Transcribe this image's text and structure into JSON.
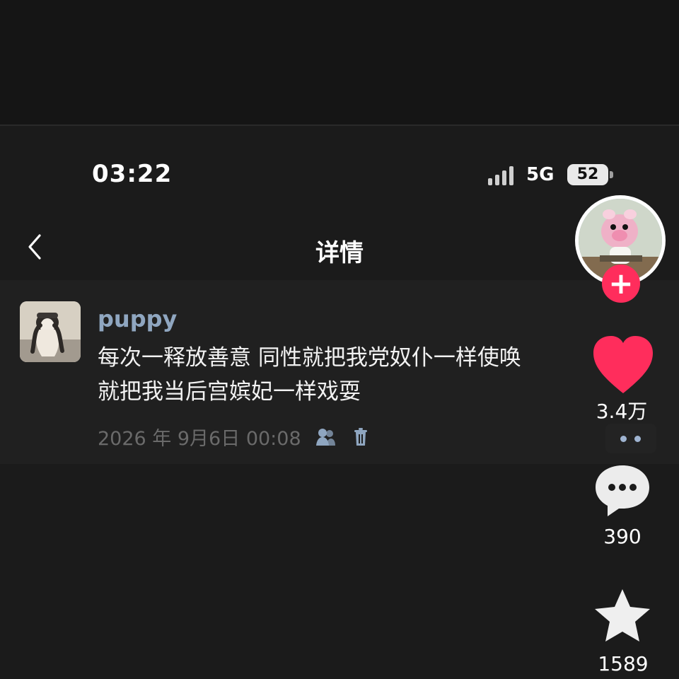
{
  "status_bar": {
    "time": "03:22",
    "network": "5G",
    "battery": "52"
  },
  "header": {
    "title": "详情"
  },
  "comment": {
    "username": "puppy",
    "text_lines": [
      "每次一释放善意 同性就把我党奴仆一样使唤",
      "就把我当后宫嫔妃一样戏耍"
    ],
    "timestamp": "2026 年 9月6日 00:08"
  },
  "side_actions": {
    "likes": "3.4万",
    "comments": "390",
    "favorites": "1589"
  },
  "icons": {
    "back": "chevron-left-icon",
    "signal": "signal-bars-icon",
    "battery": "battery-icon",
    "users": "users-icon",
    "delete": "trash-icon",
    "follow": "plus-icon",
    "like": "heart-icon",
    "more": "more-dots-icon",
    "comment": "comment-bubble-icon",
    "favorite": "star-icon"
  },
  "colors": {
    "background": "#151515",
    "screen": "#1b1b1b",
    "card": "#202020",
    "text": "#f2f2f2",
    "username": "#8fa6c0",
    "muted": "#6a6a6a",
    "like": "#ff2d5c",
    "follow": "#ff2d5c",
    "accent_blue": "#9fb4d1"
  }
}
